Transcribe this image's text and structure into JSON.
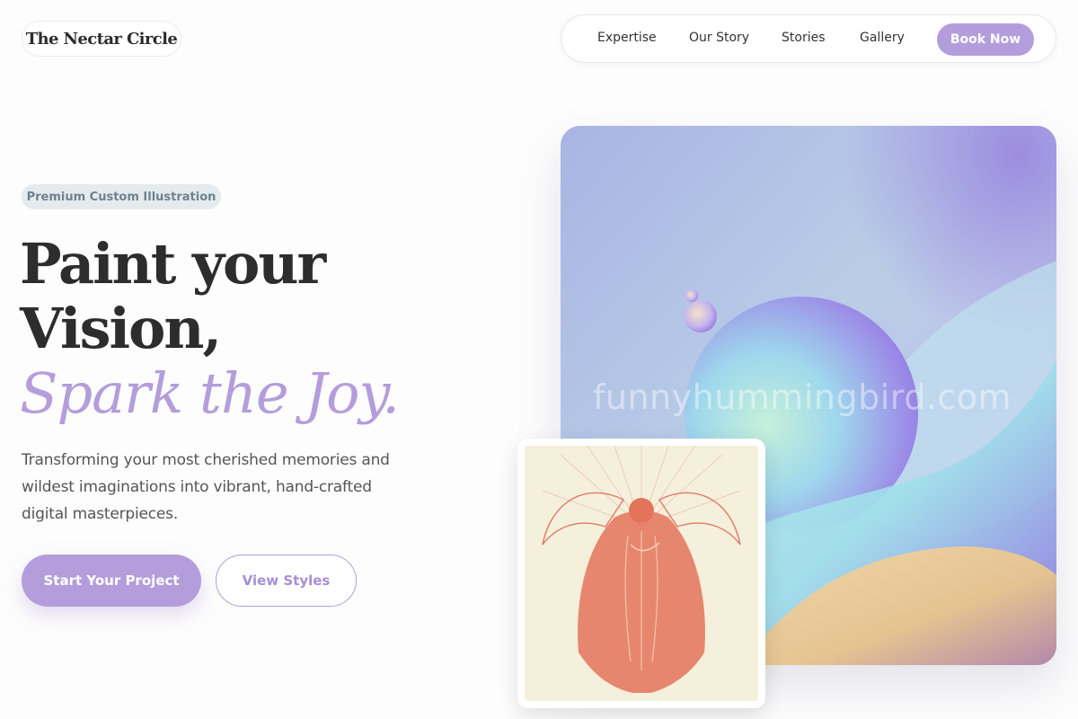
{
  "header": {
    "logo": "The Nectar Circle",
    "nav": [
      "Expertise",
      "Our Story",
      "Stories",
      "Gallery"
    ],
    "cta": "Book Now"
  },
  "hero": {
    "badge": "Premium Custom Illustration",
    "headline_line1": "Paint your",
    "headline_line2": "Vision,",
    "headline_accent": "Spark the Joy.",
    "description": "Transforming your most cherished memories and wildest imaginations into vibrant, hand-crafted digital masterpieces.",
    "primary_button": "Start Your Project",
    "secondary_button": "View Styles"
  },
  "images": {
    "main_art_watermark": "funnyhummingbird.com",
    "main_art_icon": "abstract-pastel-sphere-art",
    "small_art_icon": "winged-angel-etching"
  },
  "colors": {
    "accent": "#b39ddb",
    "text_dark": "#2d2d2d",
    "badge_bg": "#e4ebee",
    "badge_text": "#6e8290"
  }
}
